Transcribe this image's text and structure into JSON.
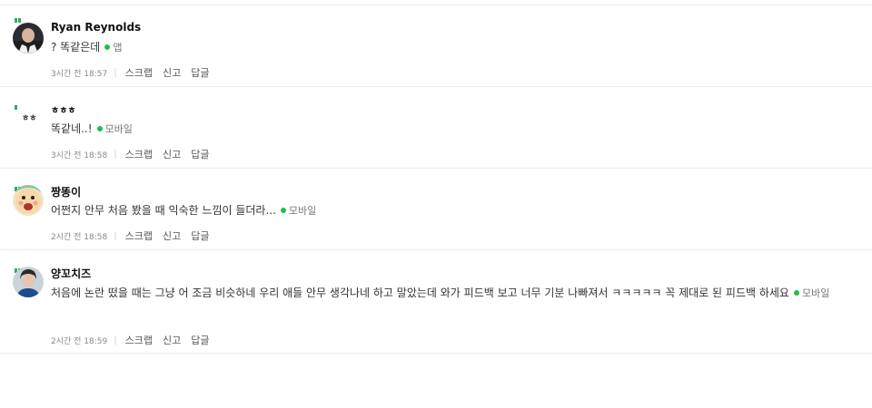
{
  "comments": [
    {
      "nickname": "Ryan Reynolds",
      "text": "? 똑같은데",
      "device": "앱",
      "time": "3시간 전 18:57",
      "avatar_icon": "man-portrait-avatar",
      "actions": [
        "스크랩",
        "신고",
        "답글"
      ]
    },
    {
      "nickname": "ㅎㅎㅎ",
      "text": "똑같네..!",
      "device": "모바일",
      "time": "3시간 전 18:58",
      "avatar_icon": "default-avatar",
      "avatar_text": "ㅎㅎ",
      "actions": [
        "스크랩",
        "신고",
        "답글"
      ]
    },
    {
      "nickname": "짱똥이",
      "text": "어쩐지 안무 처음 봤을 때 익숙한 느낌이 들더라...",
      "device": "모바일",
      "time": "2시간 전 18:58",
      "avatar_icon": "cartoon-character-avatar",
      "actions": [
        "스크랩",
        "신고",
        "답글"
      ]
    },
    {
      "nickname": "양꼬치즈",
      "text": "처음에 논란 떴을 때는 그냥 어 조금 비슷하네 우리 애들 안무 생각나네 하고 말았는데 와가 피드백 보고 너무 기분 나빠져서 ㅋㅋㅋㅋㅋ 꼭 제대로 된 피드백 하세요",
      "device": "모바일",
      "time": "2시간 전 18:59",
      "avatar_icon": "person-photo-avatar",
      "actions": [
        "스크랩",
        "신고",
        "답글"
      ]
    }
  ],
  "colors": {
    "device_dot": "#1fbf4d",
    "divider": "#ececec",
    "badge": "#3aa95a"
  }
}
